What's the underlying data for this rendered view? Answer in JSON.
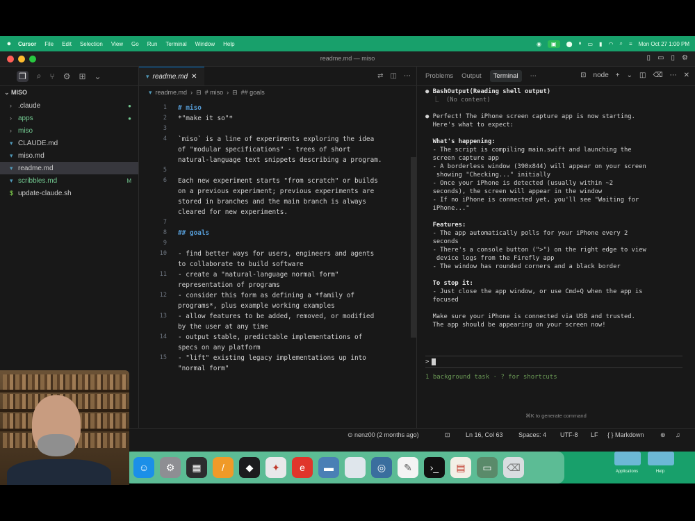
{
  "menubar": {
    "apple": "",
    "app": "Cursor",
    "items": [
      "File",
      "Edit",
      "Selection",
      "View",
      "Go",
      "Run",
      "Terminal",
      "Window",
      "Help"
    ],
    "status_chip": "",
    "clock": "Mon Oct 27 1:00 PM"
  },
  "window": {
    "title": "readme.md — miso"
  },
  "sidebar": {
    "root": "MISO",
    "items": [
      {
        "label": ".claude",
        "type": "folder",
        "badge": ""
      },
      {
        "label": "apps",
        "type": "folder",
        "badge": ""
      },
      {
        "label": "miso",
        "type": "folder",
        "badge": ""
      },
      {
        "label": "CLAUDE.md",
        "type": "file",
        "badge": ""
      },
      {
        "label": "miso.md",
        "type": "file",
        "badge": ""
      },
      {
        "label": "readme.md",
        "type": "file",
        "badge": ""
      },
      {
        "label": "scribbles.md",
        "type": "file",
        "badge": "M"
      },
      {
        "label": "update-claude.sh",
        "type": "file",
        "badge": ""
      }
    ]
  },
  "editor": {
    "tab_label": "readme.md",
    "breadcrumb": [
      "readme.md",
      "# miso",
      "## goals"
    ],
    "lines": [
      {
        "n": "1",
        "t": "# miso",
        "head": true
      },
      {
        "n": "2",
        "t": "*\"make it so\"*"
      },
      {
        "n": "3",
        "t": ""
      },
      {
        "n": "4",
        "t": "`miso` is a line of experiments exploring the idea"
      },
      {
        "n": "",
        "t": "of \"modular specifications\" - trees of short"
      },
      {
        "n": "",
        "t": "natural-language text snippets describing a program."
      },
      {
        "n": "5",
        "t": ""
      },
      {
        "n": "6",
        "t": "Each new experiment starts \"from scratch\" or builds"
      },
      {
        "n": "",
        "t": "on a previous experiment; previous experiments are"
      },
      {
        "n": "",
        "t": "stored in branches and the main branch is always"
      },
      {
        "n": "",
        "t": "cleared for new experiments."
      },
      {
        "n": "7",
        "t": ""
      },
      {
        "n": "8",
        "t": "## goals",
        "head": true
      },
      {
        "n": "9",
        "t": ""
      },
      {
        "n": "10",
        "t": "- find better ways for users, engineers and agents"
      },
      {
        "n": "",
        "t": "to collaborate to build software"
      },
      {
        "n": "11",
        "t": "- create a \"natural-language normal form\""
      },
      {
        "n": "",
        "t": "representation of programs"
      },
      {
        "n": "12",
        "t": "- consider this form as defining a *family of"
      },
      {
        "n": "",
        "t": "programs*, plus example working examples"
      },
      {
        "n": "13",
        "t": "- allow features to be added, removed, or modified"
      },
      {
        "n": "",
        "t": "by the user at any time"
      },
      {
        "n": "14",
        "t": "- output stable, predictable implementations of"
      },
      {
        "n": "",
        "t": "specs on any platform"
      },
      {
        "n": "15",
        "t": "- \"lift\" existing legacy implementations up into"
      },
      {
        "n": "",
        "t": "\"normal form\""
      }
    ]
  },
  "panel": {
    "tabs": [
      "Problems",
      "Output",
      "Terminal"
    ],
    "active_tab": "Terminal",
    "shell": "node",
    "terminal": [
      {
        "k": "bullet",
        "t": "BashOutput(Reading shell output)"
      },
      {
        "k": "sub",
        "t": "  ⎿  (No content)"
      },
      {
        "k": "blank",
        "t": ""
      },
      {
        "k": "bullet",
        "t": "Perfect! The iPhone screen capture app is now starting."
      },
      {
        "k": "plain",
        "t": "  Here's what to expect:"
      },
      {
        "k": "blank",
        "t": ""
      },
      {
        "k": "bold",
        "t": "  What's happening:"
      },
      {
        "k": "plain",
        "t": "  - The script is compiling main.swift and launching the"
      },
      {
        "k": "plain",
        "t": "  screen capture app"
      },
      {
        "k": "plain",
        "t": "  - A borderless window (390x844) will appear on your screen"
      },
      {
        "k": "plain",
        "t": "   showing \"Checking...\" initially"
      },
      {
        "k": "plain",
        "t": "  - Once your iPhone is detected (usually within ~2"
      },
      {
        "k": "plain",
        "t": "  seconds), the screen will appear in the window"
      },
      {
        "k": "plain",
        "t": "  - If no iPhone is connected yet, you'll see \"Waiting for"
      },
      {
        "k": "plain",
        "t": "  iPhone...\""
      },
      {
        "k": "blank",
        "t": ""
      },
      {
        "k": "bold",
        "t": "  Features:"
      },
      {
        "k": "plain",
        "t": "  - The app automatically polls for your iPhone every 2"
      },
      {
        "k": "plain",
        "t": "  seconds"
      },
      {
        "k": "plain",
        "t": "  - There's a console button (\">\") on the right edge to view"
      },
      {
        "k": "plain",
        "t": "   device logs from the Firefly app"
      },
      {
        "k": "plain",
        "t": "  - The window has rounded corners and a black border"
      },
      {
        "k": "blank",
        "t": ""
      },
      {
        "k": "bold",
        "t": "  To stop it:"
      },
      {
        "k": "plain",
        "t": "  - Just close the app window, or use Cmd+Q when the app is"
      },
      {
        "k": "plain",
        "t": "  focused"
      },
      {
        "k": "blank",
        "t": ""
      },
      {
        "k": "plain",
        "t": "  Make sure your iPhone is connected via USB and trusted."
      },
      {
        "k": "plain",
        "t": "  The app should be appearing on your screen now!"
      }
    ],
    "prompt": ">",
    "background_task": "1 background task · ? for shortcuts",
    "hint": "⌘K to generate command"
  },
  "statusbar": {
    "git": "nenz00 (2 months ago)",
    "position": "Ln 16, Col 63",
    "spaces": "Spaces: 4",
    "encoding": "UTF-8",
    "eol": "LF",
    "language": "{ } Markdown"
  },
  "dock": {
    "folders": [
      "Applications",
      "Help"
    ]
  }
}
